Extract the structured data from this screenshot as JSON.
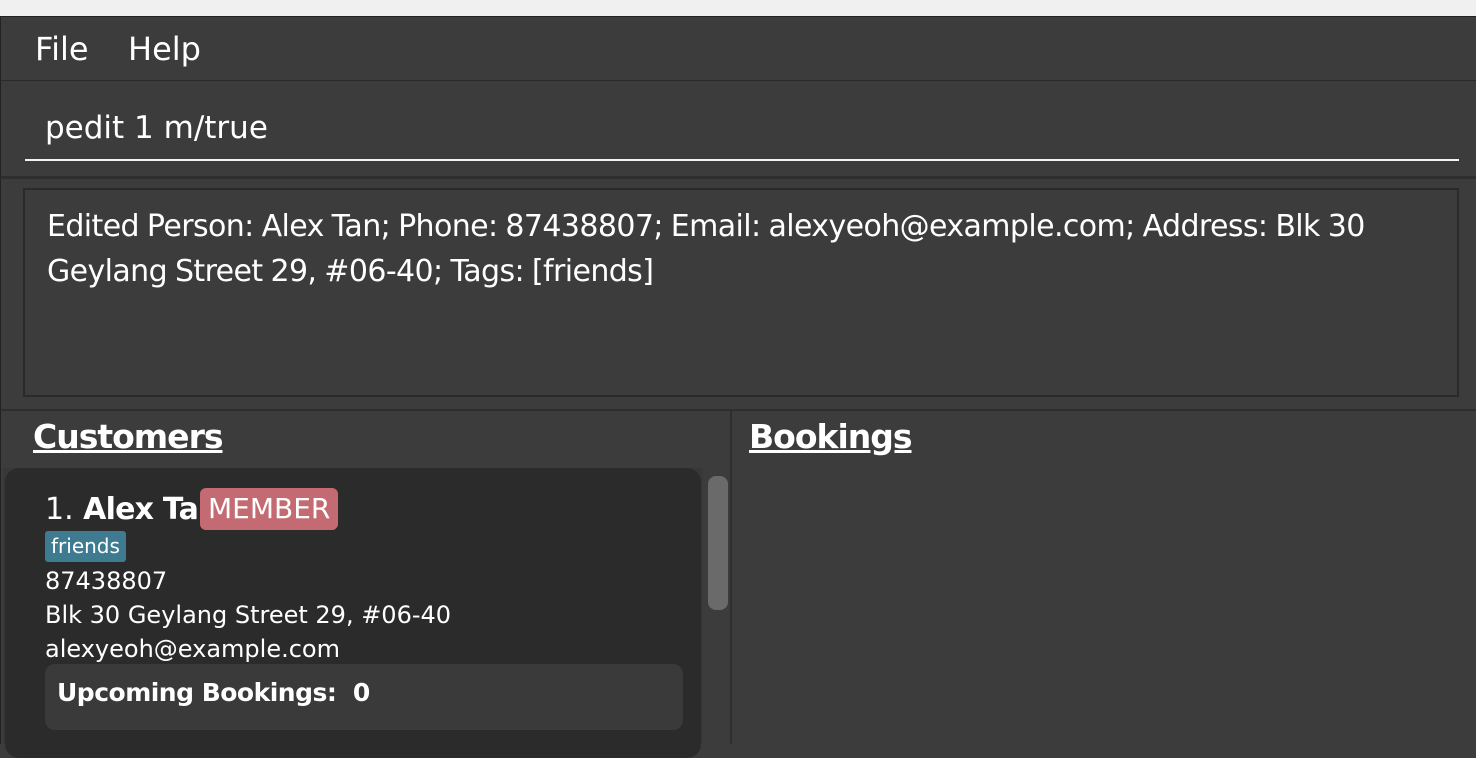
{
  "menu": {
    "file_label": "File",
    "help_label": "Help"
  },
  "command": {
    "value": "pedit 1 m/true"
  },
  "result": {
    "line1": "Edited Person: Alex Tan; Phone: 87438807; Email: alexyeoh@example.com; Address: Blk 30",
    "line2": "Geylang Street 29, #06-40; Tags: [friends]"
  },
  "customers": {
    "title": "Customers",
    "items": [
      {
        "index": "1.",
        "name": "Alex Tan",
        "badge": "MEMBER",
        "tag": "friends",
        "phone": "87438807",
        "address": "Blk 30 Geylang Street 29, #06-40",
        "email": "alexyeoh@example.com",
        "bookings_label": "Upcoming Bookings:",
        "bookings_count": "0"
      }
    ]
  },
  "bookings": {
    "title": "Bookings"
  },
  "colors": {
    "background": "#3c3c3c",
    "card": "#2b2b2b",
    "member_badge": "#c46a72",
    "tag": "#3e7b91"
  }
}
